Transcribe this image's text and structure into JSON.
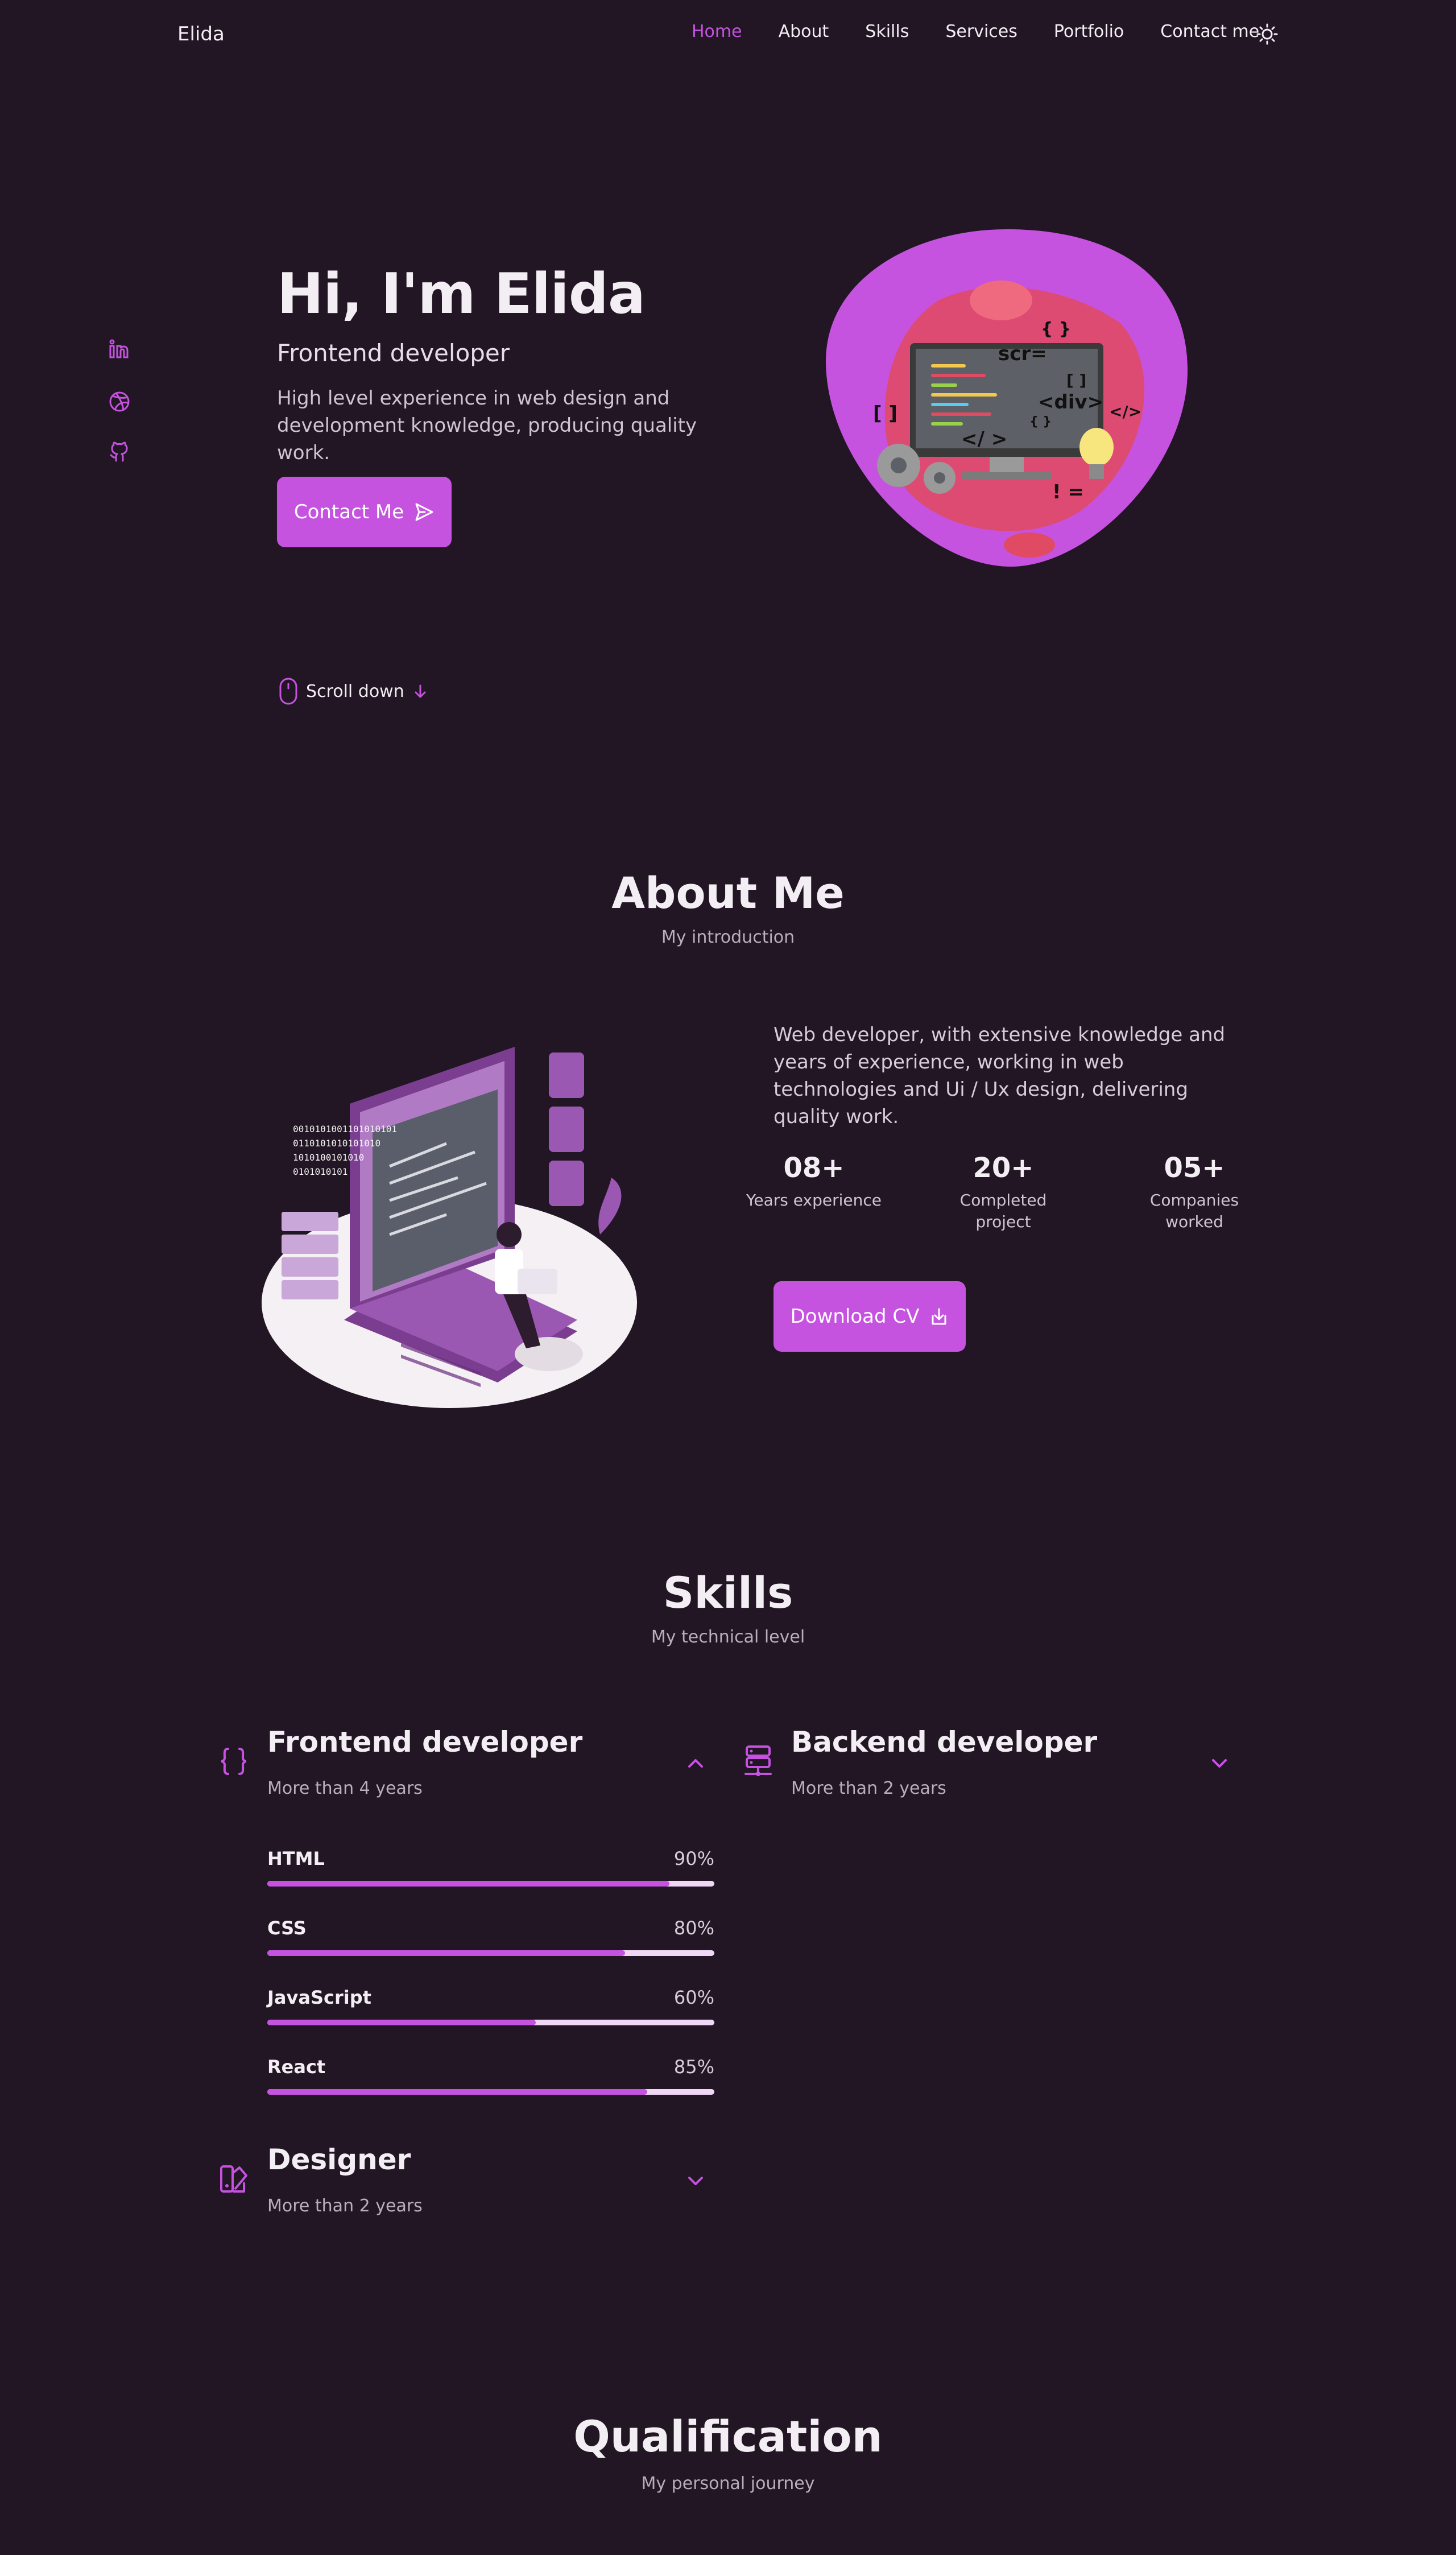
{
  "nav": {
    "logo": "Elida",
    "links": [
      "Home",
      "About",
      "Skills",
      "Services",
      "Portfolio",
      "Contact me"
    ],
    "active": "Home"
  },
  "hero": {
    "title": "Hi, I'm Elida",
    "subtitle": "Frontend developer",
    "description": "High level experience in web design and development knowledge, producing quality work.",
    "button": "Contact Me",
    "scroll": "Scroll down",
    "illustration_text": {
      "scr": "scr=",
      "braces": "{ }",
      "brackets_left": "[ ]",
      "brackets_right": "[ ]",
      "div": "<div>",
      "close_tag": "</>",
      "close_tag2": "</ >",
      "small_braces": "{ }",
      "neq": "! ="
    }
  },
  "about": {
    "title": "About Me",
    "subtitle": "My introduction",
    "description": "Web developer, with extensive knowledge and years of experience, working in web technologies and Ui / Ux design, delivering quality work.",
    "stats": [
      {
        "num": "08+",
        "label": "Years experience"
      },
      {
        "num": "20+",
        "label": "Completed project"
      },
      {
        "num": "05+",
        "label": "Companies worked"
      }
    ],
    "button": "Download CV"
  },
  "skills": {
    "title": "Skills",
    "subtitle": "My technical level",
    "groups": [
      {
        "title": "Frontend developer",
        "sub": "More than 4 years"
      },
      {
        "title": "Backend developer",
        "sub": "More than 2 years"
      },
      {
        "title": "Designer",
        "sub": "More than 2 years"
      }
    ],
    "frontend": [
      {
        "name": "HTML",
        "pct": "90%",
        "value": 0.9
      },
      {
        "name": "CSS",
        "pct": "80%",
        "value": 0.8
      },
      {
        "name": "JavaScript",
        "pct": "60%",
        "value": 0.6
      },
      {
        "name": "React",
        "pct": "85%",
        "value": 0.85
      }
    ]
  },
  "qualification": {
    "title": "Qualification",
    "subtitle": "My personal journey"
  },
  "colors": {
    "accent": "#c553e0",
    "background": "#221524"
  }
}
